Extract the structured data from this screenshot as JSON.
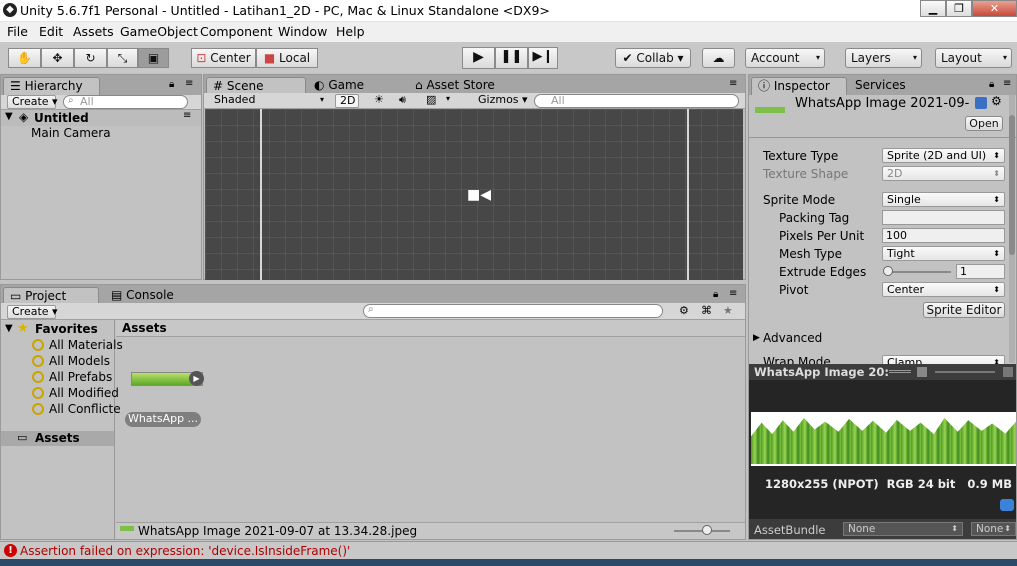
{
  "window": {
    "title": "Unity 5.6.7f1 Personal - Untitled - Latihan1_2D - PC, Mac & Linux Standalone <DX9>"
  },
  "menu": [
    "File",
    "Edit",
    "Assets",
    "GameObject",
    "Component",
    "Window",
    "Help"
  ],
  "toolbar": {
    "center_label": "Center",
    "local_label": "Local",
    "collab_label": "Collab",
    "account_label": "Account",
    "layers_label": "Layers",
    "layout_label": "Layout"
  },
  "hierarchy": {
    "tab": "Hierarchy",
    "create": "Create",
    "search_placeholder": "All",
    "scene_name": "Untitled",
    "items": [
      "Main Camera"
    ]
  },
  "scene": {
    "tabs": [
      "Scene",
      "Game",
      "Asset Store"
    ],
    "shading": "Shaded",
    "mode_2d": "2D",
    "gizmos": "Gizmos",
    "search_placeholder": "All"
  },
  "project": {
    "tabs": [
      "Project",
      "Console"
    ],
    "create": "Create",
    "favorites_label": "Favorites",
    "favorites": [
      "All Materials",
      "All Models",
      "All Prefabs",
      "All Modified",
      "All Conflicte"
    ],
    "assets_label": "Assets",
    "breadcrumb": "Assets",
    "asset_name": "WhatsApp ...",
    "selected_file": "WhatsApp Image 2021-09-07 at 13.34.28.jpeg"
  },
  "inspector": {
    "tabs": [
      "Inspector",
      "Services"
    ],
    "asset_title": "WhatsApp Image 2021-09-",
    "open_label": "Open",
    "texture_type_label": "Texture Type",
    "texture_type_value": "Sprite (2D and UI)",
    "texture_shape_label": "Texture Shape",
    "texture_shape_value": "2D",
    "sprite_mode_label": "Sprite Mode",
    "sprite_mode_value": "Single",
    "packing_tag_label": "Packing Tag",
    "packing_tag_value": "",
    "ppu_label": "Pixels Per Unit",
    "ppu_value": "100",
    "mesh_type_label": "Mesh Type",
    "mesh_type_value": "Tight",
    "extrude_label": "Extrude Edges",
    "extrude_value": "1",
    "pivot_label": "Pivot",
    "pivot_value": "Center",
    "sprite_editor_label": "Sprite Editor",
    "advanced_label": "Advanced",
    "wrap_mode_label": "Wrap Mode",
    "wrap_mode_value": "Clamp",
    "preview_title": "WhatsApp Image 20:",
    "preview_info": "1280x255 (NPOT)  RGB 24 bit   0.9 MB",
    "assetbundle_label": "AssetBundle",
    "assetbundle_value": "None",
    "assetbundle_variant": "None"
  },
  "status": {
    "message": "Assertion failed on expression: 'device.IsInsideFrame()'",
    "error_color": "#d00000"
  }
}
